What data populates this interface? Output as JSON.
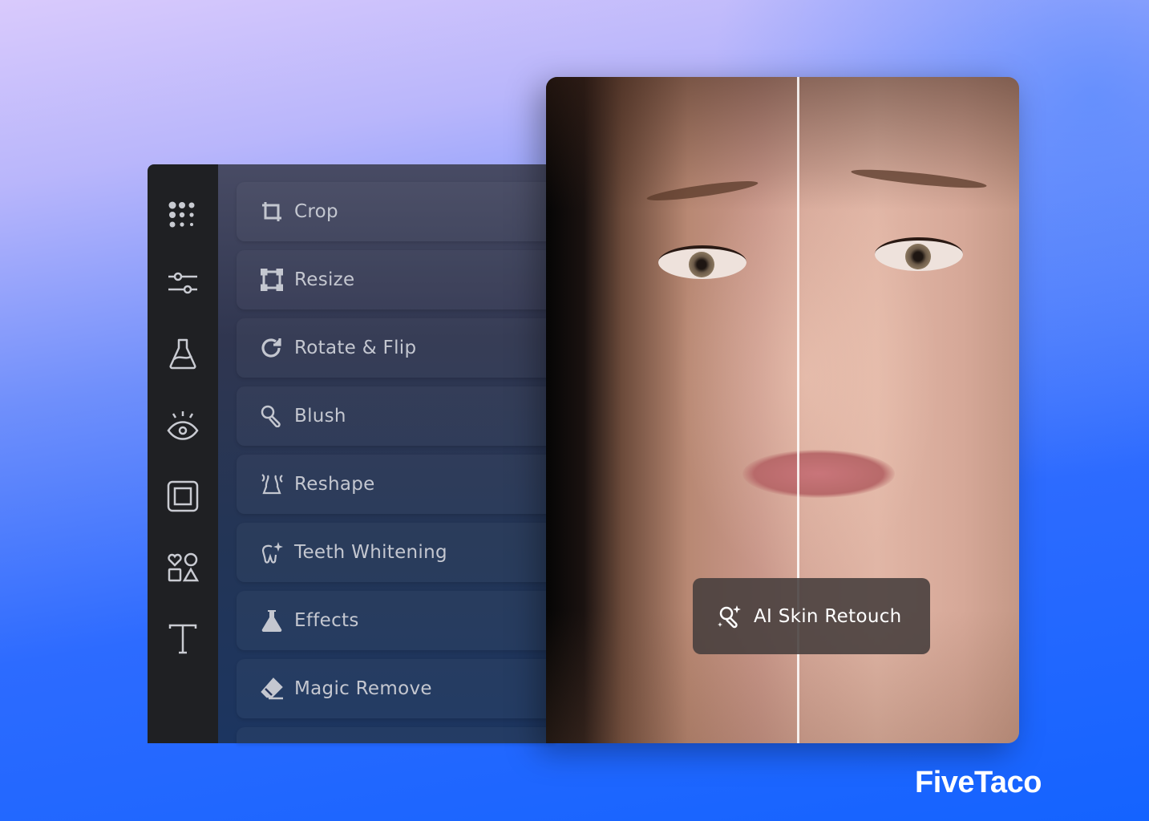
{
  "sidebar": {
    "icons": [
      "apps-grid-icon",
      "sliders-icon",
      "flask-icon",
      "eye-icon",
      "frame-icon",
      "shapes-icon",
      "text-icon"
    ]
  },
  "menu": {
    "items": [
      {
        "label": "Crop",
        "icon": "crop-icon"
      },
      {
        "label": "Resize",
        "icon": "resize-icon"
      },
      {
        "label": "Rotate & Flip",
        "icon": "rotate-icon"
      },
      {
        "label": "Blush",
        "icon": "blush-brush-icon"
      },
      {
        "label": "Reshape",
        "icon": "reshape-icon"
      },
      {
        "label": "Teeth Whitening",
        "icon": "tooth-sparkle-icon"
      },
      {
        "label": "Effects",
        "icon": "flask-filled-icon"
      },
      {
        "label": "Magic Remove",
        "icon": "eraser-icon"
      }
    ]
  },
  "preview": {
    "badge_label": "AI Skin Retouch",
    "badge_icon": "magic-retouch-icon"
  },
  "brand": {
    "logo": "FiveTaco"
  }
}
